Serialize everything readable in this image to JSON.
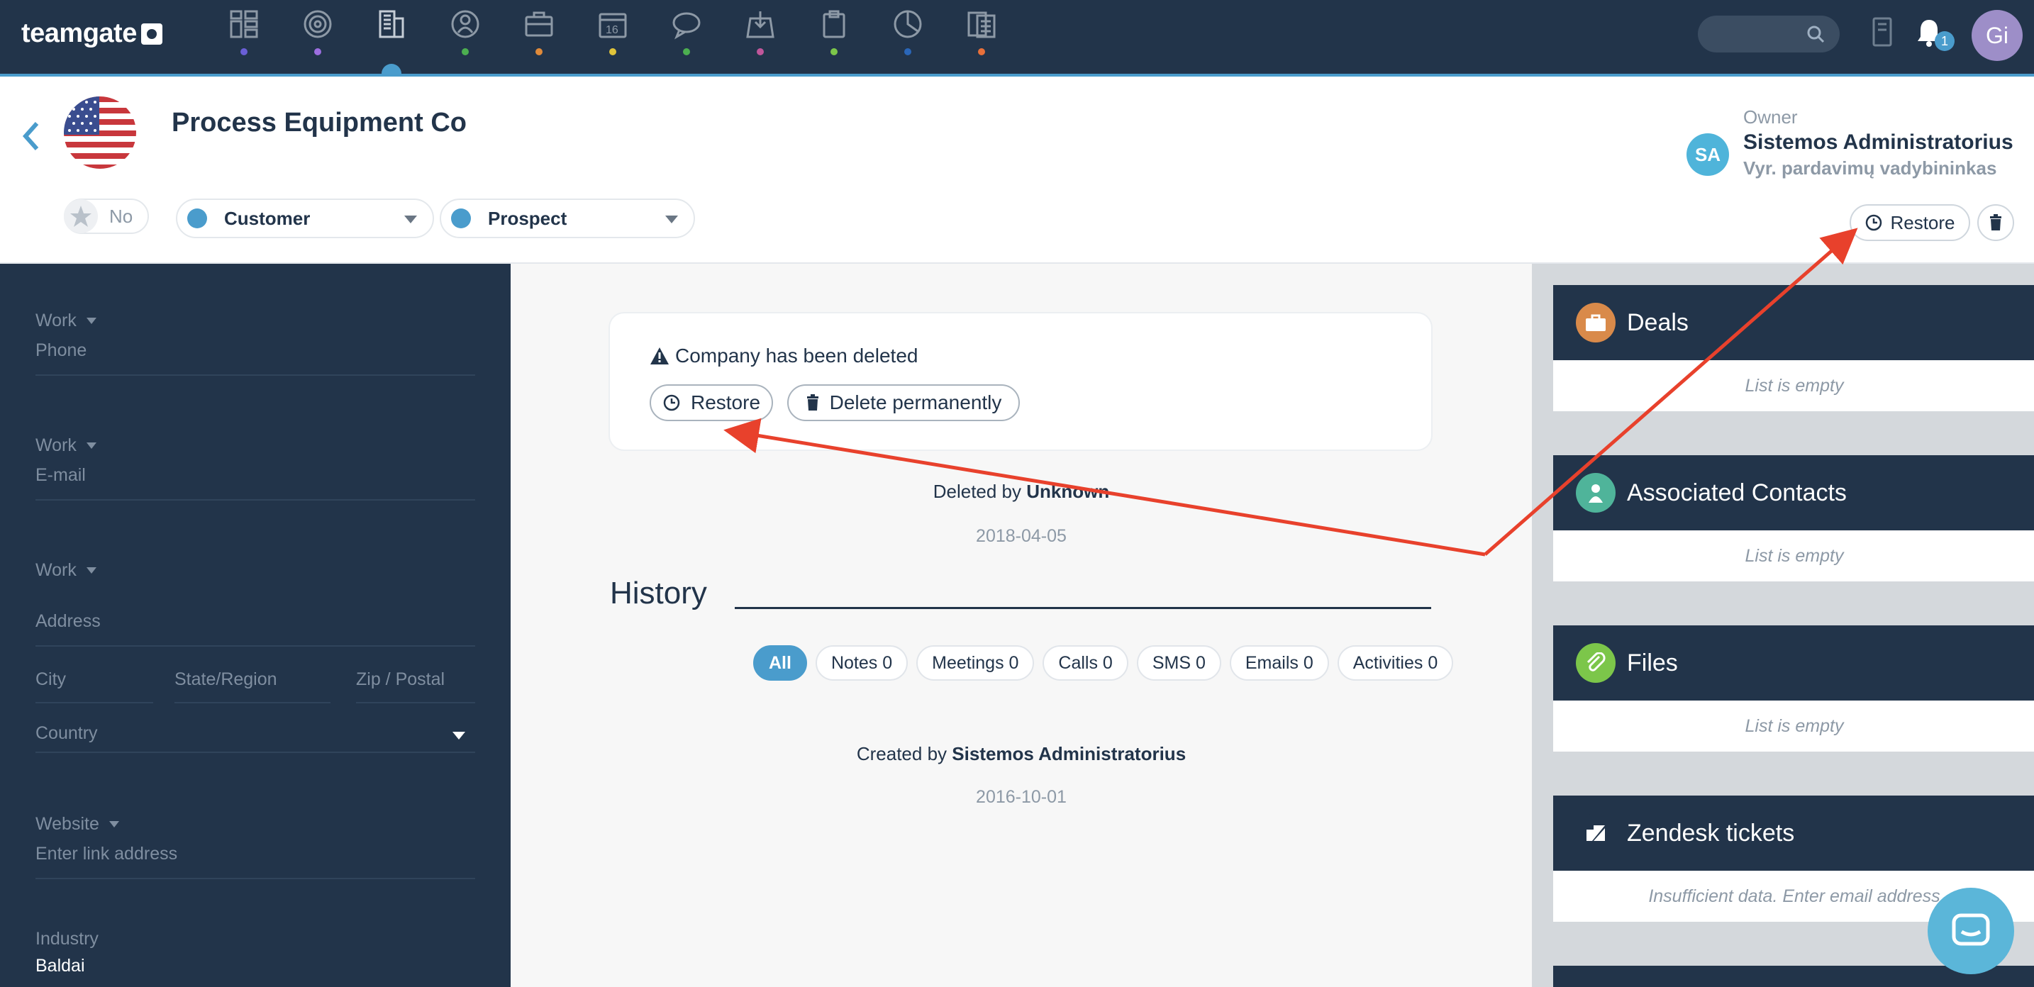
{
  "app": {
    "logo_text": "teamgate"
  },
  "nav": {
    "items": [
      {
        "name": "dashboard",
        "dot": "#6a5fd6"
      },
      {
        "name": "goals",
        "dot": "#9c6ee0"
      },
      {
        "name": "companies",
        "dot": "#4a9ccc",
        "active": true
      },
      {
        "name": "people",
        "dot": "#4caf50"
      },
      {
        "name": "deals",
        "dot": "#e08a3a"
      },
      {
        "name": "calendar",
        "dot": "#e0c43a"
      },
      {
        "name": "conversations",
        "dot": "#4caf50"
      },
      {
        "name": "inbox",
        "dot": "#c0569a"
      },
      {
        "name": "files",
        "dot": "#7cc64a"
      },
      {
        "name": "reports",
        "dot": "#2a66b8"
      },
      {
        "name": "documents",
        "dot": "#e8703a"
      }
    ],
    "notification_count": "1",
    "user_initials": "Gi"
  },
  "header": {
    "company_name": "Process Equipment Co",
    "favorite_label": "No",
    "type_select": "Customer",
    "status_select": "Prospect",
    "owner_label": "Owner",
    "owner_initials": "SA",
    "owner_name": "Sistemos Administratorius",
    "owner_role": "Vyr. pardavimų vadybininkas",
    "restore_label": "Restore"
  },
  "left_panel": {
    "phone": {
      "type": "Work",
      "placeholder": "Phone"
    },
    "email": {
      "type": "Work",
      "placeholder": "E-mail"
    },
    "address": {
      "type": "Work",
      "placeholder": "Address",
      "city": "City",
      "state": "State/Region",
      "zip": "Zip / Postal",
      "country": "Country"
    },
    "website": {
      "type": "Website",
      "placeholder": "Enter link address"
    },
    "industry": {
      "label": "Industry",
      "value": "Baldai"
    }
  },
  "center": {
    "deleted_message": "Company has been deleted",
    "restore_button": "Restore",
    "delete_permanently_button": "Delete permanently",
    "deleted_by_prefix": "Deleted by",
    "deleted_by": "Unknown",
    "deleted_date": "2018-04-05",
    "history_title": "History",
    "filters": [
      "All",
      "Notes 0",
      "Meetings 0",
      "Calls 0",
      "SMS 0",
      "Emails 0",
      "Activities 0"
    ],
    "created_by_prefix": "Created by",
    "created_by": "Sistemos Administratorius",
    "created_date": "2016-10-01"
  },
  "right_panel": {
    "widgets": [
      {
        "title": "Deals",
        "body": "List is empty",
        "icon": "briefcase-icon",
        "color": "#d98a4a"
      },
      {
        "title": "Associated Contacts",
        "body": "List is empty",
        "icon": "person-icon",
        "color": "#4fb49a"
      },
      {
        "title": "Files",
        "body": "List is empty",
        "icon": "paperclip-icon",
        "color": "#7cc64a"
      },
      {
        "title": "Zendesk tickets",
        "body": "Insufficient data. Enter email address",
        "icon": "zendesk-icon",
        "color": "#22344a"
      }
    ]
  },
  "colors": {
    "nav_bg": "#22344a",
    "accent": "#4a9ccc",
    "annotation_arrow": "#e8412c"
  }
}
